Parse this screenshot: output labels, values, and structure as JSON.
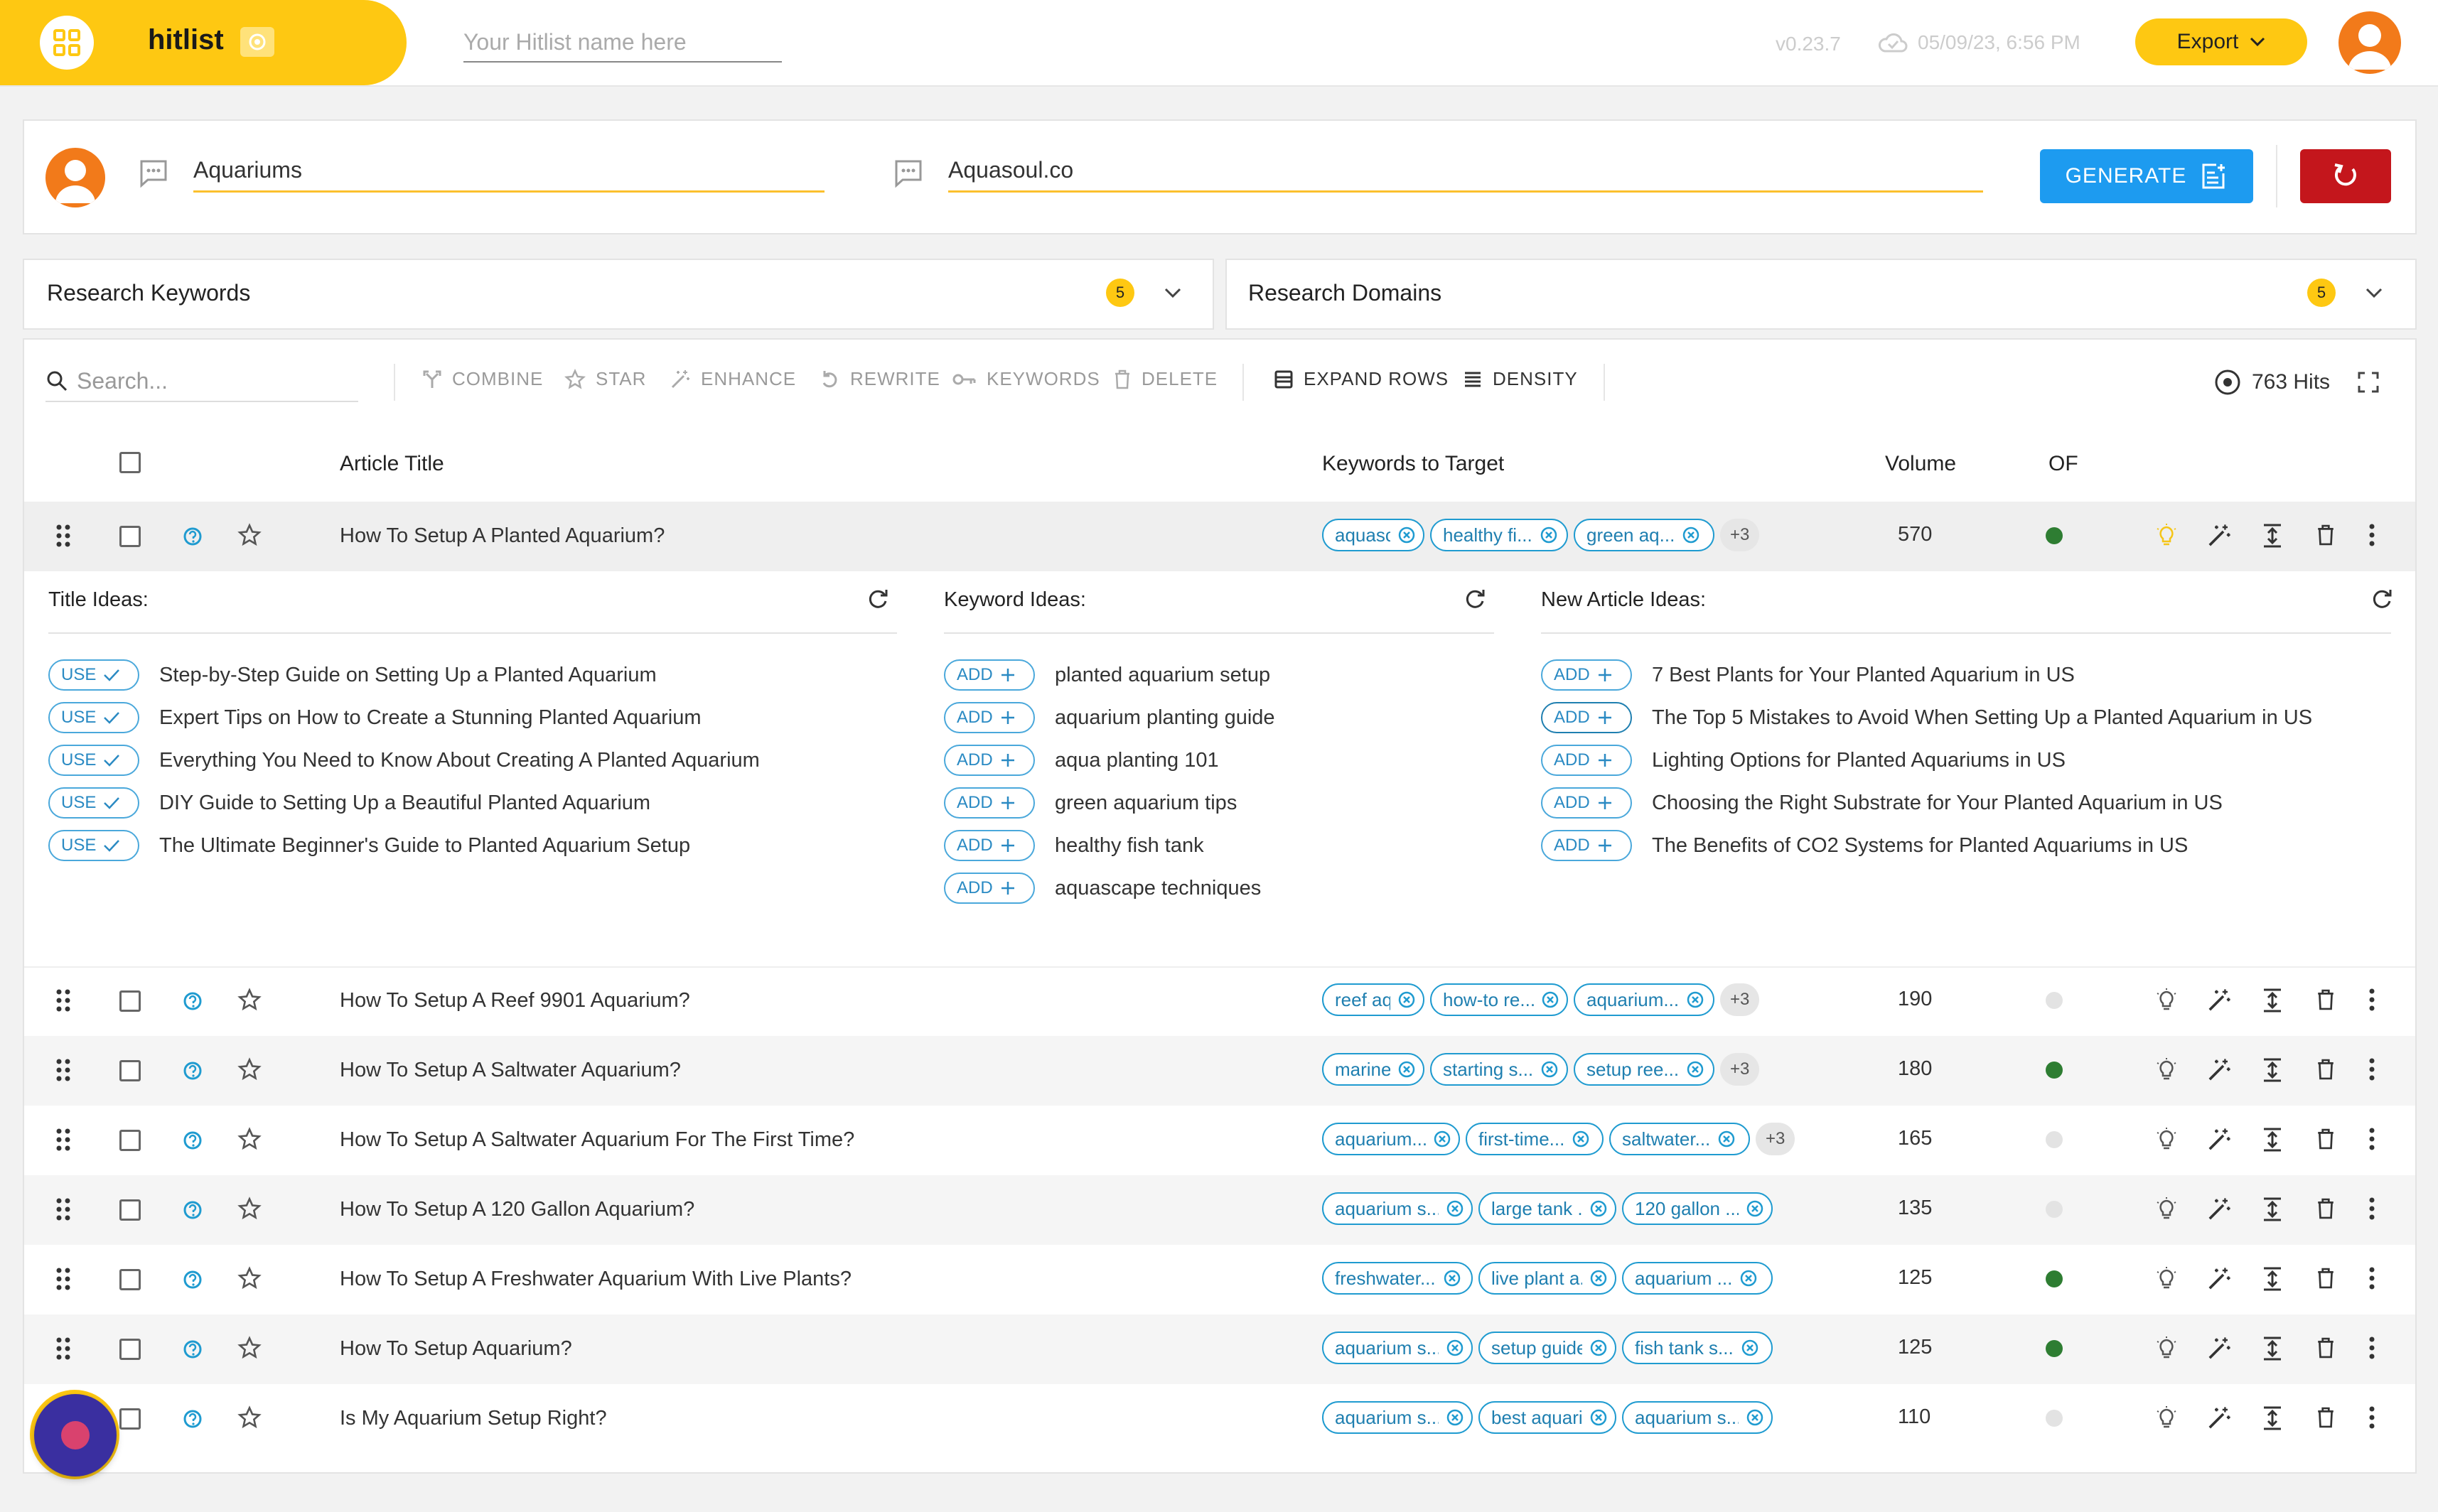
{
  "app": {
    "name": "hitlist",
    "version": "v0.23.7",
    "saved": "05/09/23, 6:56 PM",
    "export_label": "Export"
  },
  "hitlist_name": {
    "placeholder": "Your Hitlist name here",
    "value": ""
  },
  "generator": {
    "topic": "Aquariums",
    "domain": "Aquasoul.co",
    "generate_label": "GENERATE"
  },
  "panels": {
    "keywords": {
      "title": "Research Keywords",
      "count": "5"
    },
    "domains": {
      "title": "Research Domains",
      "count": "5"
    }
  },
  "toolbar": {
    "search_placeholder": "Search...",
    "combine": "COMBINE",
    "star": "STAR",
    "enhance": "ENHANCE",
    "rewrite": "REWRITE",
    "keywords": "KEYWORDS",
    "delete": "DELETE",
    "expand_rows": "EXPAND ROWS",
    "density": "DENSITY",
    "hits": "763 Hits"
  },
  "table": {
    "headers": {
      "title": "Article Title",
      "keywords": "Keywords to Target",
      "volume": "Volume",
      "of": "OF"
    },
    "rows": [
      {
        "title": "How To Setup A Planted Aquarium?",
        "chips": [
          "aquasca...",
          "healthy fi...",
          "green aq..."
        ],
        "more": "+3",
        "volume": "570",
        "of_active": true
      },
      {
        "title": "How To Setup A Reef 9901 Aquarium?",
        "chips": [
          "reef aqua...",
          "how-to re...",
          "aquarium..."
        ],
        "more": "+3",
        "volume": "190",
        "of_active": false
      },
      {
        "title": "How To Setup A Saltwater Aquarium?",
        "chips": [
          "marine ta...",
          "starting s...",
          "setup ree..."
        ],
        "more": "+3",
        "volume": "180",
        "of_active": true
      },
      {
        "title": "How To Setup A Saltwater Aquarium For The First Time?",
        "chips": [
          "aquarium...",
          "first-time...",
          "saltwater..."
        ],
        "more": "+3",
        "volume": "165",
        "of_active": false
      },
      {
        "title": "How To Setup A 120 Gallon Aquarium?",
        "chips": [
          "aquarium s...",
          "large tank ...",
          "120 gallon ..."
        ],
        "more": "",
        "volume": "135",
        "of_active": false
      },
      {
        "title": "How To Setup A Freshwater Aquarium With Live Plants?",
        "chips": [
          "freshwater...",
          "live plant a...",
          "aquarium ..."
        ],
        "more": "",
        "volume": "125",
        "of_active": true
      },
      {
        "title": "How To Setup Aquarium?",
        "chips": [
          "aquarium s...",
          "setup guide",
          "fish tank s..."
        ],
        "more": "",
        "volume": "125",
        "of_active": true
      },
      {
        "title": "Is My Aquarium Setup Right?",
        "chips": [
          "aquarium s...",
          "best aquari...",
          "aquarium s..."
        ],
        "more": "",
        "volume": "110",
        "of_active": false
      }
    ]
  },
  "expanded": {
    "title_ideas": {
      "heading": "Title Ideas:",
      "action": "USE",
      "items": [
        "Step-by-Step Guide on Setting Up a Planted Aquarium",
        "Expert Tips on How to Create a Stunning Planted Aquarium",
        "Everything You Need to Know About Creating A Planted Aquarium",
        "DIY Guide to Setting Up a Beautiful Planted Aquarium",
        "The Ultimate Beginner's Guide to Planted Aquarium Setup"
      ]
    },
    "keyword_ideas": {
      "heading": "Keyword Ideas:",
      "action": "ADD",
      "items": [
        "planted aquarium setup",
        "aquarium planting guide",
        "aqua planting 101",
        "green aquarium tips",
        "healthy fish tank",
        "aquascape techniques"
      ]
    },
    "article_ideas": {
      "heading": "New Article Ideas:",
      "action": "ADD",
      "items": [
        "7 Best Plants for Your Planted Aquarium in US",
        "The Top 5 Mistakes to Avoid When Setting Up a Planted Aquarium in US",
        "Lighting Options for Planted Aquariums in US",
        "Choosing the Right Substrate for Your Planted Aquarium in US",
        "The Benefits of CO2 Systems for Planted Aquariums in US"
      ]
    }
  },
  "colors": {
    "brand": "#fec812",
    "primary": "#1d9bf0",
    "danger": "#c4161c",
    "chip": "#1f9bd0",
    "of_active": "#2e7d32",
    "of_inactive": "#e3e3e3"
  }
}
